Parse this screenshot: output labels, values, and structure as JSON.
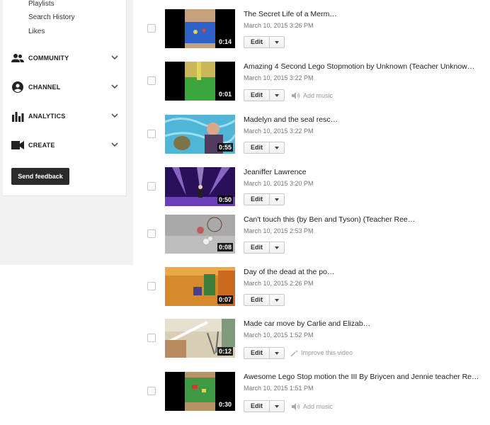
{
  "sidebar": {
    "sub_links": [
      "Playlists",
      "Search History",
      "Likes"
    ],
    "sections": [
      {
        "label": "COMMUNITY",
        "icon": "community-icon"
      },
      {
        "label": "CHANNEL",
        "icon": "channel-icon"
      },
      {
        "label": "ANALYTICS",
        "icon": "analytics-icon"
      },
      {
        "label": "CREATE",
        "icon": "create-icon"
      }
    ],
    "feedback_label": "Send feedback"
  },
  "videos": [
    {
      "title": "The Secret Life of a Merm…",
      "date": "March 10, 2015 3:26 PM",
      "duration": "0:14",
      "edit_label": "Edit",
      "action": ""
    },
    {
      "title": "Amazing 4 Second Lego Stopmotion by Unknown (Teacher Unknow…",
      "date": "March 10, 2015 3:22 PM",
      "duration": "0:01",
      "edit_label": "Edit",
      "action": "Add music"
    },
    {
      "title": "Madelyn and the seal resc…",
      "date": "March 10, 2015 3:22 PM",
      "duration": "0:55",
      "edit_label": "Edit",
      "action": ""
    },
    {
      "title": "Jeaniffer Lawrence",
      "date": "March 10, 2015 3:20 PM",
      "duration": "0:50",
      "edit_label": "Edit",
      "action": ""
    },
    {
      "title": "Can't touch this (by Ben and Tyson) (Teacher Ree…",
      "date": "March 10, 2015 2:53 PM",
      "duration": "0:08",
      "edit_label": "Edit",
      "action": ""
    },
    {
      "title": "Day of the dead at the po…",
      "date": "March 10, 2015 2:26 PM",
      "duration": "0:07",
      "edit_label": "Edit",
      "action": ""
    },
    {
      "title": "Made car move by Carlie and Elizab…",
      "date": "March 10, 2015 1:52 PM",
      "duration": "0:12",
      "edit_label": "Edit",
      "action": "Improve this video"
    },
    {
      "title": "Awesome Lego Stop motion the III By Briycen and Jennie teacher Re…",
      "date": "March 10, 2015 1:51 PM",
      "duration": "0:30",
      "edit_label": "Edit",
      "action": "Add music"
    }
  ],
  "colors": {
    "accent_dark": "#2b2b2b",
    "link_gray": "#999999"
  }
}
